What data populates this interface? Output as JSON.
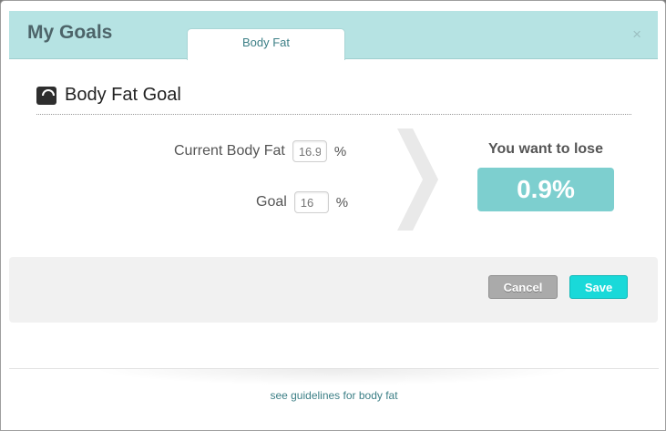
{
  "header": {
    "title": "My Goals",
    "tab_label": "Body Fat",
    "close_label": "×"
  },
  "section": {
    "title": "Body Fat Goal",
    "icon": "scale-icon"
  },
  "fields": {
    "current": {
      "label": "Current Body Fat",
      "placeholder": "16.9",
      "unit": "%"
    },
    "goal": {
      "label": "Goal",
      "placeholder": "16",
      "unit": "%"
    }
  },
  "result": {
    "heading": "You want to lose",
    "value": "0.9%"
  },
  "buttons": {
    "cancel": "Cancel",
    "save": "Save"
  },
  "footer": {
    "link": "see guidelines for body fat"
  },
  "colors": {
    "header_bg": "#b6e3e3",
    "accent": "#19d9d9",
    "result_bg": "#7dcfcf"
  }
}
